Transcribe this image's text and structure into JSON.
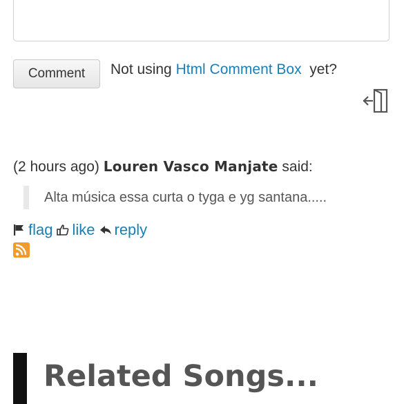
{
  "comment_form": {
    "textarea_value": "",
    "button_label": "Comment",
    "promo_prefix": "Not using ",
    "promo_link": "Html Comment Box",
    "promo_suffix": "  yet?"
  },
  "comments": [
    {
      "time": "(2 hours ago)",
      "author": "Louren Vasco Manjate",
      "said": "said:",
      "text": "Alta música essa curta o tyga e yg santana.....",
      "actions": {
        "flag": "flag",
        "like": "like",
        "reply": "reply"
      }
    }
  ],
  "related": {
    "title": "Related Songs..."
  },
  "colors": {
    "link": "#1a7fb5",
    "text": "#333333",
    "heading": "#555555",
    "rss": "#f29a2e"
  },
  "icons": [
    "logout-icon",
    "flag-icon",
    "thumbs-up-icon",
    "reply-icon",
    "rss-icon"
  ]
}
